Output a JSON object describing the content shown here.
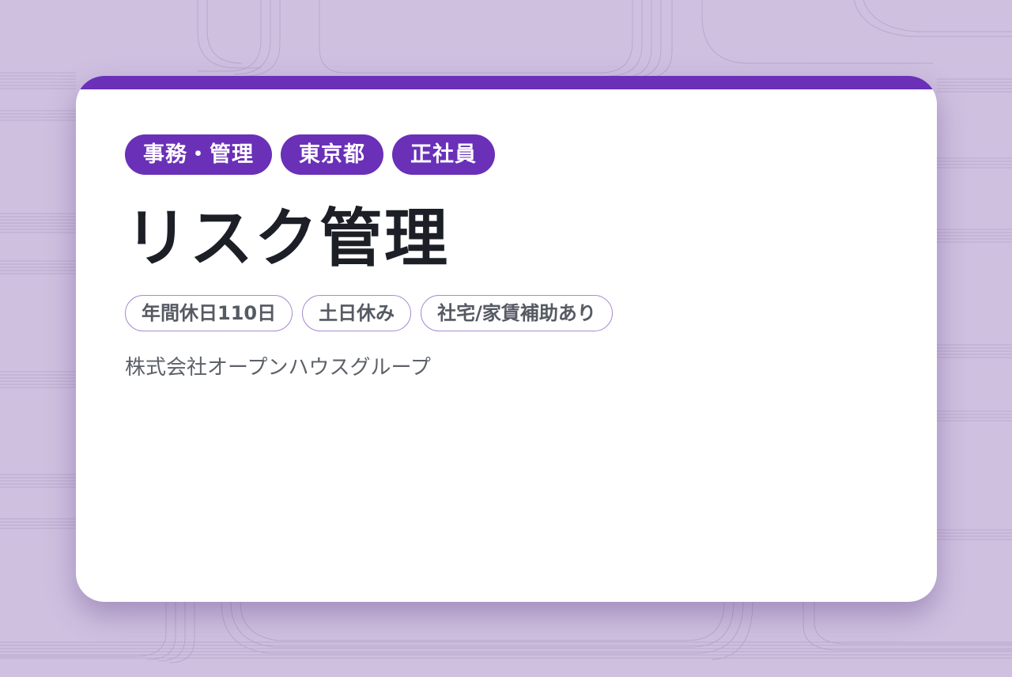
{
  "job": {
    "category_tags": [
      "事務・管理",
      "東京都",
      "正社員"
    ],
    "title": "リスク管理",
    "feature_tags": [
      "年間休日110日",
      "土日休み",
      "社宅/家賃補助あり"
    ],
    "company": "株式会社オープンハウスグループ"
  },
  "colors": {
    "background": "#cfc0e0",
    "accent": "#6a30b8",
    "card": "#ffffff",
    "title_text": "#1d1f27",
    "muted_text": "#5d6168",
    "tag_border": "#a98bcf"
  }
}
